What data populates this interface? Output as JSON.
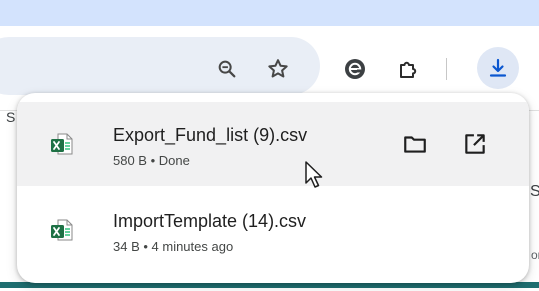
{
  "toolbar": {
    "icons": [
      "zoom-icon",
      "bookmark-star-icon",
      "extension-e-icon",
      "extensions-puzzle-icon",
      "download-icon"
    ]
  },
  "page_behind": {
    "left_char": "S",
    "right_char": "S",
    "right_small": "or"
  },
  "downloads": {
    "items": [
      {
        "name": "Export_Fund_list (9).csv",
        "meta": "580 B • Done",
        "icon": "excel-csv-icon",
        "actions": [
          "folder-icon",
          "open-external-icon"
        ]
      },
      {
        "name": "ImportTemplate (14).csv",
        "meta": "34 B • 4 minutes ago",
        "icon": "excel-csv-icon"
      }
    ]
  },
  "colors": {
    "tabstrip": "#d3e3fd",
    "omnibox": "#e9eef6",
    "download_accent": "#0b57d0",
    "excel_green": "#1e7145",
    "hover_row": "#f1f1f2"
  }
}
